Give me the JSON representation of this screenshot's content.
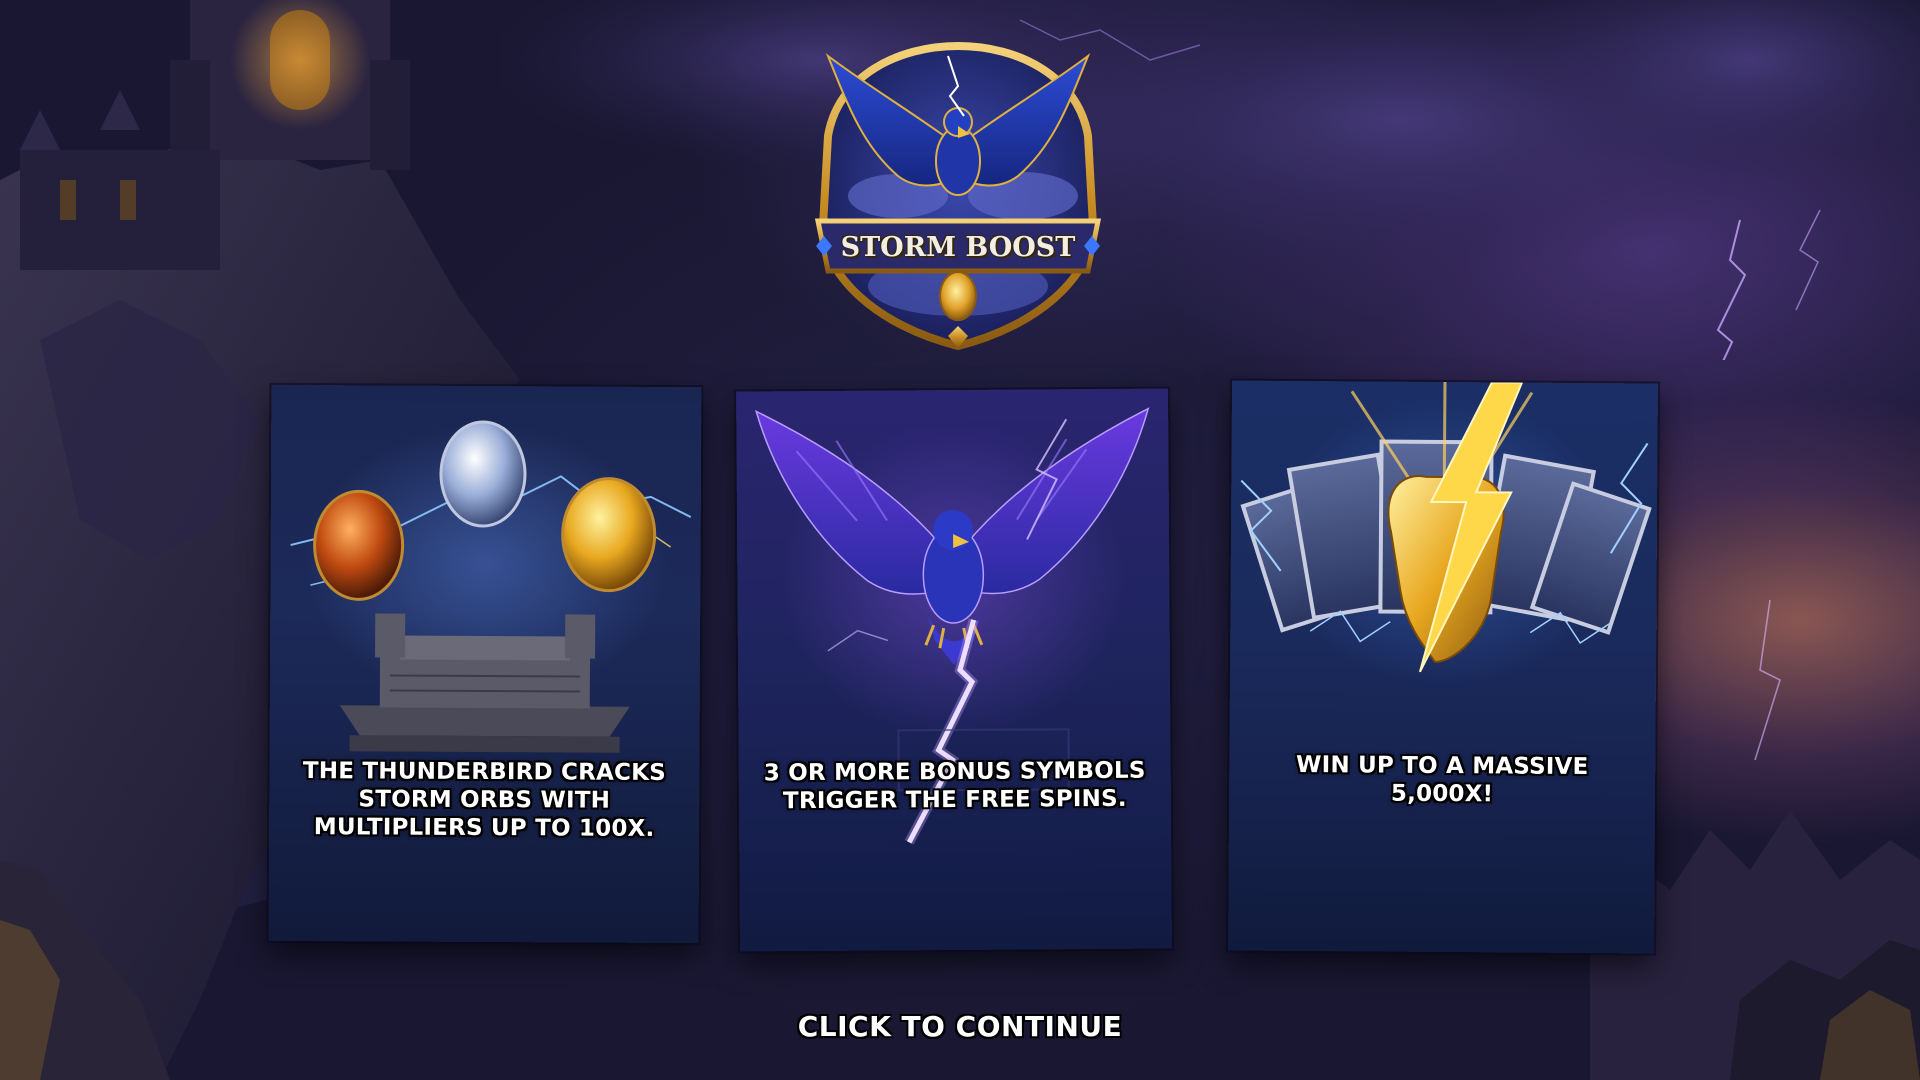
{
  "game": {
    "logo_title": "STORM BOOST"
  },
  "cards": [
    {
      "text": "THE THUNDERBIRD CRACKS STORM ORBS WITH MULTIPLIERS UP TO 100X.",
      "art": "storm-orbs-on-altar"
    },
    {
      "text": "3 OR MORE BONUS SYMBOLS TRIGGER THE FREE SPINS.",
      "art": "thunderbird-with-lightning"
    },
    {
      "text": "WIN UP TO A MASSIVE 5,000X!",
      "art": "golden-talon-with-cards"
    }
  ],
  "continue_label": "CLICK TO CONTINUE",
  "colors": {
    "background": "#1a1830",
    "text": "#ffffff",
    "gold": "#e0a92a",
    "storm_purple": "#8a5cf0",
    "storm_blue": "#3a6fe0"
  }
}
